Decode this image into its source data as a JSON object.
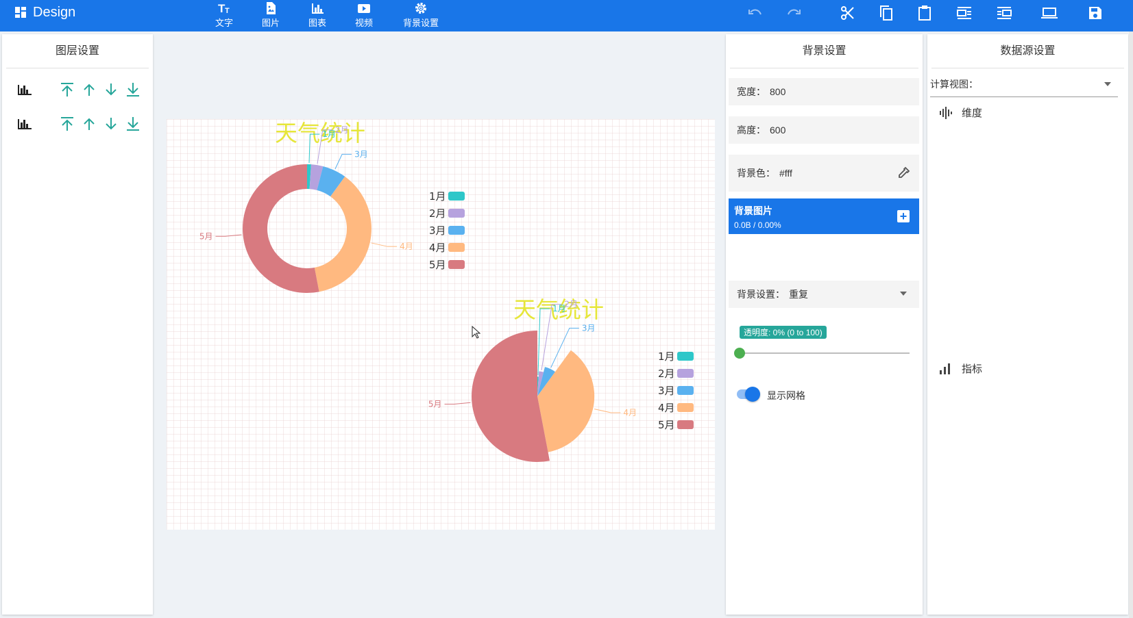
{
  "app": {
    "title": "Design"
  },
  "toolbar": {
    "tools": [
      {
        "label": "文字",
        "icon": "text-icon"
      },
      {
        "label": "图片",
        "icon": "image-icon"
      },
      {
        "label": "图表",
        "icon": "chart-icon"
      },
      {
        "label": "视频",
        "icon": "video-icon"
      },
      {
        "label": "背景设置",
        "icon": "gear-icon"
      }
    ],
    "actions": [
      "undo-icon",
      "redo-icon",
      "cut-icon",
      "copy-icon",
      "paste-icon",
      "align-left-icon",
      "align-right-icon",
      "preview-icon",
      "save-icon"
    ]
  },
  "layers_panel": {
    "title": "图层设置",
    "layers": [
      {
        "icon": "bar-chart-icon"
      },
      {
        "icon": "bar-chart-icon"
      }
    ]
  },
  "canvas": {
    "width": 800,
    "height": 600
  },
  "background_panel": {
    "title": "背景设置",
    "width_label": "宽度：",
    "width_value": "800",
    "height_label": "高度：",
    "height_value": "600",
    "bgcolor_label": "背景色：",
    "bgcolor_value": "#fff",
    "image_label": "背景图片",
    "image_progress": "0.0B / 0.00%",
    "repeat_label": "背景设置：",
    "repeat_value": "重复",
    "opacity_label": "透明度: 0% (0 to 100)",
    "opacity_value": 0,
    "grid_label": "显示网格",
    "grid_on": true
  },
  "datasource_panel": {
    "title": "数据源设置",
    "view_label": "计算视图：",
    "dimension_label": "维度",
    "metric_label": "指标"
  },
  "colors": {
    "primary": "#1976e8",
    "teal": "#26a69a",
    "c1": "#2ec7c9",
    "c2": "#b6a2de",
    "c3": "#5ab1ef",
    "c4": "#ffb980",
    "c5": "#d87a80"
  },
  "chart_data": [
    {
      "type": "pie",
      "variant": "donut",
      "title": "天气统计",
      "categories": [
        "1月",
        "2月",
        "3月",
        "4月",
        "5月"
      ],
      "values": [
        1,
        3,
        6,
        37,
        53
      ],
      "legend": [
        "1月",
        "2月",
        "3月",
        "4月",
        "5月"
      ],
      "legend_position": "right"
    },
    {
      "type": "pie",
      "variant": "rose",
      "title": "天气统计",
      "categories": [
        "1月",
        "2月",
        "3月",
        "4月",
        "5月"
      ],
      "values": [
        1,
        3,
        6,
        37,
        53
      ],
      "legend": [
        "1月",
        "2月",
        "3月",
        "4月",
        "5月"
      ],
      "legend_position": "right"
    }
  ]
}
